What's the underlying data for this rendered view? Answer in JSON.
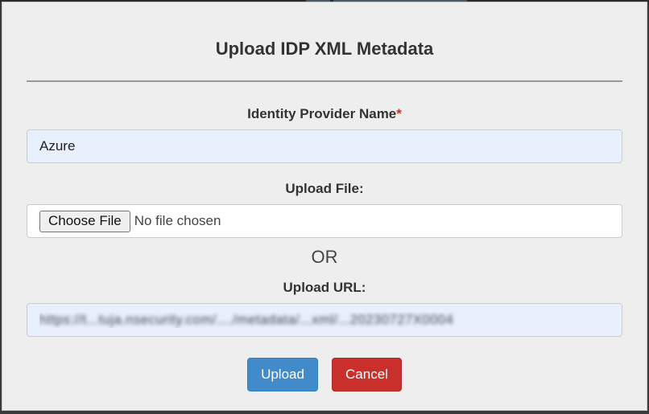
{
  "modal": {
    "title": "Upload IDP XML Metadata"
  },
  "idp_name": {
    "label": "Identity Provider Name",
    "required_marker": "*",
    "value": "Azure"
  },
  "upload_file": {
    "label": "Upload File:",
    "button_label": "Choose File",
    "status_text": "No file chosen"
  },
  "separator_text": "OR",
  "upload_url": {
    "label": "Upload URL:",
    "value": "https://t...tuja.nsecurity.com/..../metadata/...xml/...20230727X0004"
  },
  "actions": {
    "upload_label": "Upload",
    "cancel_label": "Cancel"
  },
  "colors": {
    "upload_button": "#428bca",
    "cancel_button": "#c9302c",
    "required_star": "#c9302c",
    "autofill_input_bg": "#e8f0fe"
  }
}
